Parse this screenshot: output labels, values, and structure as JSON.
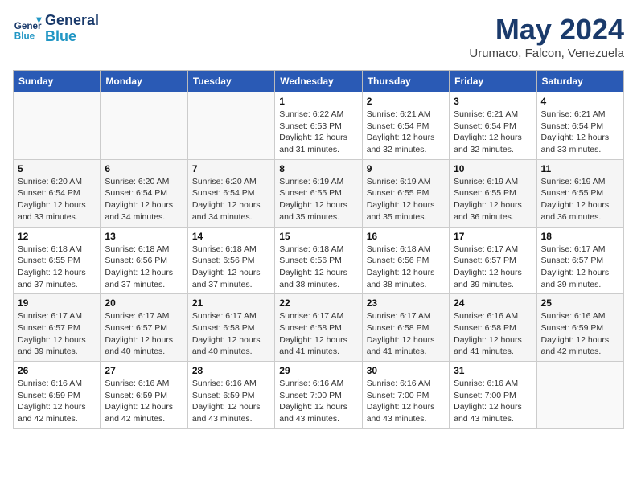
{
  "header": {
    "logo_line1": "General",
    "logo_line2": "Blue",
    "month_title": "May 2024",
    "subtitle": "Urumaco, Falcon, Venezuela"
  },
  "weekdays": [
    "Sunday",
    "Monday",
    "Tuesday",
    "Wednesday",
    "Thursday",
    "Friday",
    "Saturday"
  ],
  "weeks": [
    [
      {
        "day": "",
        "info": ""
      },
      {
        "day": "",
        "info": ""
      },
      {
        "day": "",
        "info": ""
      },
      {
        "day": "1",
        "info": "Sunrise: 6:22 AM\nSunset: 6:53 PM\nDaylight: 12 hours\nand 31 minutes."
      },
      {
        "day": "2",
        "info": "Sunrise: 6:21 AM\nSunset: 6:54 PM\nDaylight: 12 hours\nand 32 minutes."
      },
      {
        "day": "3",
        "info": "Sunrise: 6:21 AM\nSunset: 6:54 PM\nDaylight: 12 hours\nand 32 minutes."
      },
      {
        "day": "4",
        "info": "Sunrise: 6:21 AM\nSunset: 6:54 PM\nDaylight: 12 hours\nand 33 minutes."
      }
    ],
    [
      {
        "day": "5",
        "info": "Sunrise: 6:20 AM\nSunset: 6:54 PM\nDaylight: 12 hours\nand 33 minutes."
      },
      {
        "day": "6",
        "info": "Sunrise: 6:20 AM\nSunset: 6:54 PM\nDaylight: 12 hours\nand 34 minutes."
      },
      {
        "day": "7",
        "info": "Sunrise: 6:20 AM\nSunset: 6:54 PM\nDaylight: 12 hours\nand 34 minutes."
      },
      {
        "day": "8",
        "info": "Sunrise: 6:19 AM\nSunset: 6:55 PM\nDaylight: 12 hours\nand 35 minutes."
      },
      {
        "day": "9",
        "info": "Sunrise: 6:19 AM\nSunset: 6:55 PM\nDaylight: 12 hours\nand 35 minutes."
      },
      {
        "day": "10",
        "info": "Sunrise: 6:19 AM\nSunset: 6:55 PM\nDaylight: 12 hours\nand 36 minutes."
      },
      {
        "day": "11",
        "info": "Sunrise: 6:19 AM\nSunset: 6:55 PM\nDaylight: 12 hours\nand 36 minutes."
      }
    ],
    [
      {
        "day": "12",
        "info": "Sunrise: 6:18 AM\nSunset: 6:55 PM\nDaylight: 12 hours\nand 37 minutes."
      },
      {
        "day": "13",
        "info": "Sunrise: 6:18 AM\nSunset: 6:56 PM\nDaylight: 12 hours\nand 37 minutes."
      },
      {
        "day": "14",
        "info": "Sunrise: 6:18 AM\nSunset: 6:56 PM\nDaylight: 12 hours\nand 37 minutes."
      },
      {
        "day": "15",
        "info": "Sunrise: 6:18 AM\nSunset: 6:56 PM\nDaylight: 12 hours\nand 38 minutes."
      },
      {
        "day": "16",
        "info": "Sunrise: 6:18 AM\nSunset: 6:56 PM\nDaylight: 12 hours\nand 38 minutes."
      },
      {
        "day": "17",
        "info": "Sunrise: 6:17 AM\nSunset: 6:57 PM\nDaylight: 12 hours\nand 39 minutes."
      },
      {
        "day": "18",
        "info": "Sunrise: 6:17 AM\nSunset: 6:57 PM\nDaylight: 12 hours\nand 39 minutes."
      }
    ],
    [
      {
        "day": "19",
        "info": "Sunrise: 6:17 AM\nSunset: 6:57 PM\nDaylight: 12 hours\nand 39 minutes."
      },
      {
        "day": "20",
        "info": "Sunrise: 6:17 AM\nSunset: 6:57 PM\nDaylight: 12 hours\nand 40 minutes."
      },
      {
        "day": "21",
        "info": "Sunrise: 6:17 AM\nSunset: 6:58 PM\nDaylight: 12 hours\nand 40 minutes."
      },
      {
        "day": "22",
        "info": "Sunrise: 6:17 AM\nSunset: 6:58 PM\nDaylight: 12 hours\nand 41 minutes."
      },
      {
        "day": "23",
        "info": "Sunrise: 6:17 AM\nSunset: 6:58 PM\nDaylight: 12 hours\nand 41 minutes."
      },
      {
        "day": "24",
        "info": "Sunrise: 6:16 AM\nSunset: 6:58 PM\nDaylight: 12 hours\nand 41 minutes."
      },
      {
        "day": "25",
        "info": "Sunrise: 6:16 AM\nSunset: 6:59 PM\nDaylight: 12 hours\nand 42 minutes."
      }
    ],
    [
      {
        "day": "26",
        "info": "Sunrise: 6:16 AM\nSunset: 6:59 PM\nDaylight: 12 hours\nand 42 minutes."
      },
      {
        "day": "27",
        "info": "Sunrise: 6:16 AM\nSunset: 6:59 PM\nDaylight: 12 hours\nand 42 minutes."
      },
      {
        "day": "28",
        "info": "Sunrise: 6:16 AM\nSunset: 6:59 PM\nDaylight: 12 hours\nand 43 minutes."
      },
      {
        "day": "29",
        "info": "Sunrise: 6:16 AM\nSunset: 7:00 PM\nDaylight: 12 hours\nand 43 minutes."
      },
      {
        "day": "30",
        "info": "Sunrise: 6:16 AM\nSunset: 7:00 PM\nDaylight: 12 hours\nand 43 minutes."
      },
      {
        "day": "31",
        "info": "Sunrise: 6:16 AM\nSunset: 7:00 PM\nDaylight: 12 hours\nand 43 minutes."
      },
      {
        "day": "",
        "info": ""
      }
    ]
  ]
}
